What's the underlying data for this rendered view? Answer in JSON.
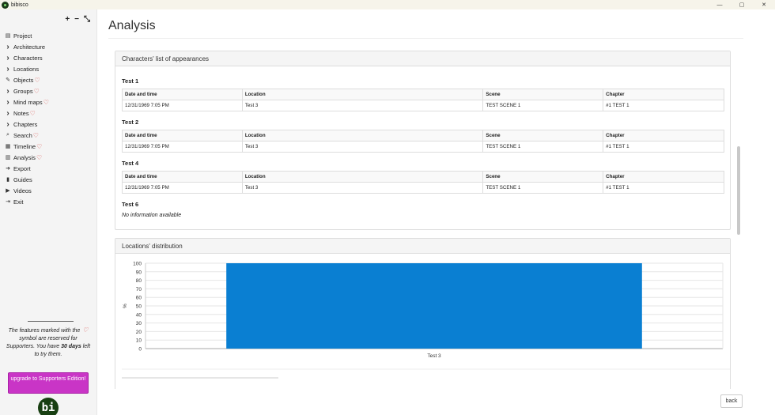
{
  "window": {
    "title": "bibisco",
    "controls": [
      "—",
      "▢",
      "✕"
    ]
  },
  "sidebar": {
    "tools": [
      "+",
      "−",
      "⤡"
    ],
    "items": [
      {
        "label": "Project",
        "icon": "project-icon",
        "heart": false
      },
      {
        "label": "Architecture",
        "icon": "chevron-right-icon",
        "heart": false
      },
      {
        "label": "Characters",
        "icon": "chevron-right-icon",
        "heart": false
      },
      {
        "label": "Locations",
        "icon": "chevron-right-icon",
        "heart": false
      },
      {
        "label": "Objects",
        "icon": "pencil-icon",
        "heart": true
      },
      {
        "label": "Groups",
        "icon": "chevron-right-icon",
        "heart": true
      },
      {
        "label": "Mind maps",
        "icon": "chevron-right-icon",
        "heart": true
      },
      {
        "label": "Notes",
        "icon": "chevron-right-icon",
        "heart": true
      },
      {
        "label": "Chapters",
        "icon": "chevron-right-icon",
        "heart": false
      },
      {
        "label": "Search",
        "icon": "search-icon",
        "heart": true
      },
      {
        "label": "Timeline",
        "icon": "calendar-icon",
        "heart": true
      },
      {
        "label": "Analysis",
        "icon": "chart-icon",
        "heart": true
      },
      {
        "label": "Export",
        "icon": "export-icon",
        "heart": false
      },
      {
        "label": "Guides",
        "icon": "book-icon",
        "heart": false
      },
      {
        "label": "Videos",
        "icon": "video-icon",
        "heart": false
      },
      {
        "label": "Exit",
        "icon": "exit-icon",
        "heart": false
      }
    ],
    "supporter_note": {
      "part1": "The features marked with the",
      "part2": "symbol are reserved for Supporters. You have",
      "days": "30 days",
      "part3": "left to try them."
    },
    "upgrade_label": "upgrade to Supporters Edition!",
    "logo_text": "bi"
  },
  "main": {
    "title": "Analysis",
    "appearances_panel": {
      "title": "Characters' list of appearances",
      "columns": [
        "Date and time",
        "Location",
        "Scene",
        "Chapter"
      ],
      "characters": [
        {
          "name": "Test 1",
          "rows": [
            [
              "12/31/1969 7:05 PM",
              "Test 3",
              "TEST SCENE 1",
              "#1 TEST 1"
            ]
          ]
        },
        {
          "name": "Test 2",
          "rows": [
            [
              "12/31/1969 7:05 PM",
              "Test 3",
              "TEST SCENE 1",
              "#1 TEST 1"
            ]
          ]
        },
        {
          "name": "Test 4",
          "rows": [
            [
              "12/31/1969 7:05 PM",
              "Test 3",
              "TEST SCENE 1",
              "#1 TEST 1"
            ]
          ]
        },
        {
          "name": "Test 6",
          "no_info": "No information available"
        }
      ]
    },
    "locations_panel": {
      "title": "Locations' distribution"
    },
    "back_label": "back"
  },
  "chart_data": {
    "type": "bar",
    "categories": [
      "Test 3"
    ],
    "values": [
      100
    ],
    "ylabel": "%",
    "ylim": [
      0,
      100
    ],
    "yticks": [
      0,
      10,
      20,
      30,
      40,
      50,
      60,
      70,
      80,
      90,
      100
    ],
    "grid": true,
    "colors": {
      "bar": "#0a7fd2"
    }
  }
}
